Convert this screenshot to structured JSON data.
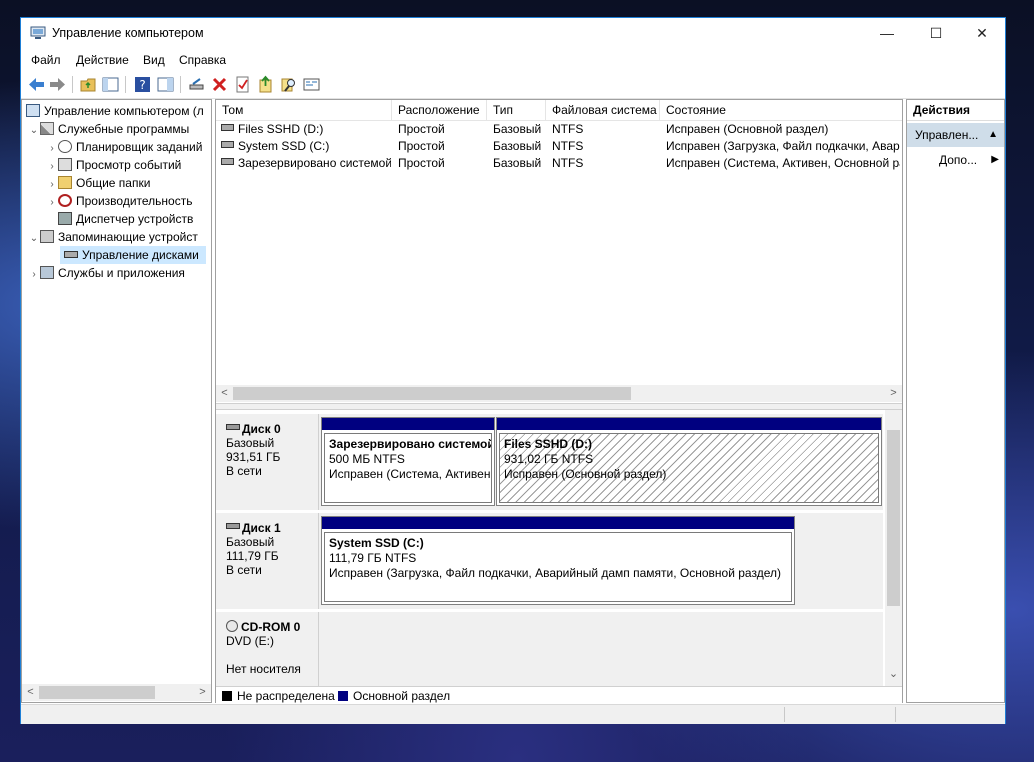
{
  "window": {
    "title": "Управление компьютером",
    "minimize": "—",
    "maximize": "☐",
    "close": "✕"
  },
  "menu": [
    "Файл",
    "Действие",
    "Вид",
    "Справка"
  ],
  "tree": {
    "root": "Управление компьютером (л",
    "system_tools": "Служебные программы",
    "task_scheduler": "Планировщик заданий",
    "event_viewer": "Просмотр событий",
    "shared_folders": "Общие папки",
    "performance": "Производительность",
    "device_manager": "Диспетчер устройств",
    "storage": "Запоминающие устройст",
    "disk_management": "Управление дисками",
    "services_apps": "Службы и приложения"
  },
  "volume_table": {
    "columns": [
      "Том",
      "Расположение",
      "Тип",
      "Файловая система",
      "Состояние"
    ],
    "rows": [
      [
        "Files SSHD (D:)",
        "Простой",
        "Базовый",
        "NTFS",
        "Исправен (Основной раздел)"
      ],
      [
        "System SSD (C:)",
        "Простой",
        "Базовый",
        "NTFS",
        "Исправен (Загрузка, Файл подкачки, Авари"
      ],
      [
        "Зарезервировано системой",
        "Простой",
        "Базовый",
        "NTFS",
        "Исправен (Система, Активен, Основной ра"
      ]
    ]
  },
  "disks": {
    "disk0": {
      "name": "Диск 0",
      "type": "Базовый",
      "size": "931,51 ГБ",
      "status": "В сети",
      "partitions": [
        {
          "name": "Зарезервировано системой",
          "size": "500 МБ NTFS",
          "status": "Исправен (Система, Активен"
        },
        {
          "name": "Files SSHD  (D:)",
          "size": "931,02 ГБ NTFS",
          "status": "Исправен (Основной раздел)"
        }
      ]
    },
    "disk1": {
      "name": "Диск 1",
      "type": "Базовый",
      "size": "111,79 ГБ",
      "status": "В сети",
      "partitions": [
        {
          "name": "System SSD  (C:)",
          "size": "111,79 ГБ NTFS",
          "status": "Исправен (Загрузка, Файл подкачки, Аварийный дамп памяти, Основной раздел)"
        }
      ]
    },
    "cdrom0": {
      "name": "CD-ROM 0",
      "drive": "DVD (E:)",
      "status": "Нет носителя"
    }
  },
  "legend": {
    "unallocated": "Не распределена",
    "primary": "Основной раздел"
  },
  "actions": {
    "header": "Действия",
    "section": "Управлен...",
    "more": "Допо..."
  },
  "colors": {
    "primary_partition": "#000080",
    "unallocated": "#000000",
    "selection": "#cce8ff",
    "accent_border": "#1e7fd6"
  }
}
